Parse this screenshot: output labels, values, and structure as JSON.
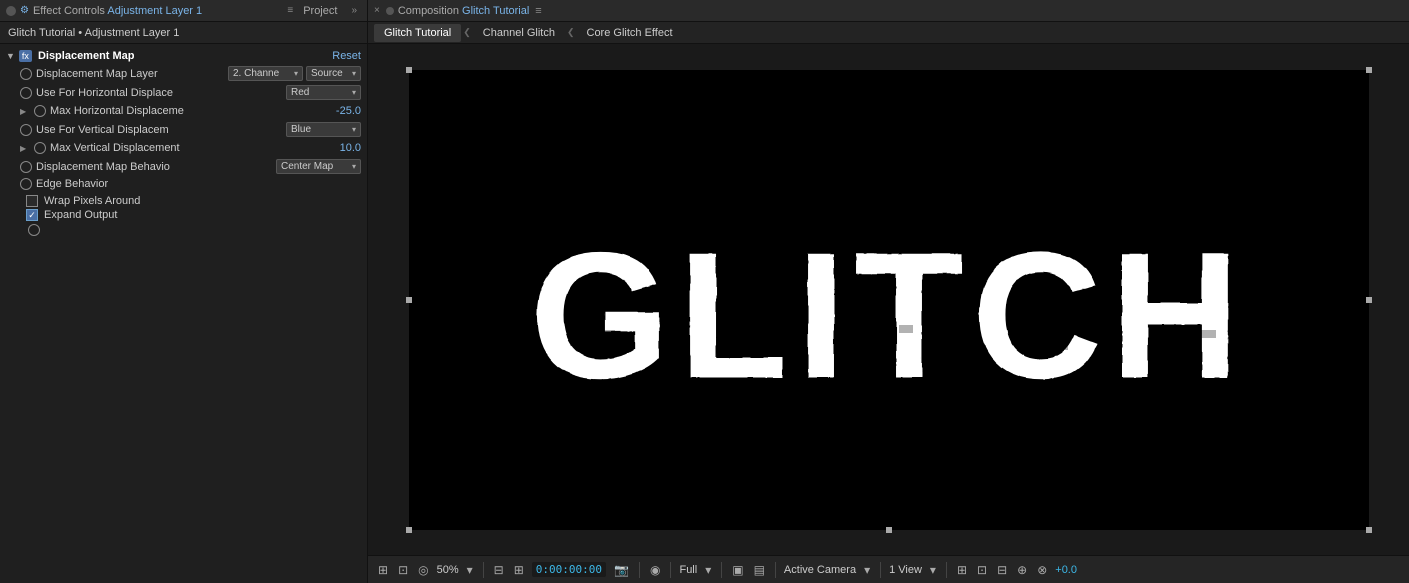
{
  "topBar": {
    "closeBtn": "×",
    "fxIcon": "fx",
    "panelTitle": "Effect Controls",
    "panelTitleHighlight": "Adjustment Layer 1",
    "menuIcon": "≡",
    "projectLabel": "Project",
    "expandIcon": "»",
    "rightClose": "×",
    "rightSaveDot": "●",
    "compLabel": "Composition",
    "compName": "Glitch Tutorial",
    "rightMenuIcon": "≡"
  },
  "secondRow": {
    "breadcrumb": "Glitch Tutorial • Adjustment Layer 1",
    "tabs": [
      {
        "id": "glitch-tutorial",
        "label": "Glitch Tutorial",
        "active": true
      },
      {
        "id": "channel-glitch",
        "label": "Channel Glitch",
        "active": false
      },
      {
        "id": "core-glitch",
        "label": "Core Glitch Effect",
        "active": false
      }
    ]
  },
  "effectControls": {
    "effectName": "Displacement Map",
    "resetLabel": "Reset",
    "rows": [
      {
        "id": "displacement-map-layer",
        "label": "Displacement Map Layer",
        "hasTriangle": false,
        "hasStopwatch": false,
        "valueType": "double-dropdown",
        "value1": "2. Channe",
        "value2": "Source"
      },
      {
        "id": "use-horizontal",
        "label": "Use For Horizontal Displace",
        "hasTriangle": false,
        "hasStopwatch": true,
        "valueType": "dropdown",
        "value": "Red"
      },
      {
        "id": "max-horizontal",
        "label": "Max Horizontal Displaceme",
        "hasTriangle": true,
        "hasStopwatch": true,
        "valueType": "number",
        "value": "-25.0"
      },
      {
        "id": "use-vertical",
        "label": "Use For Vertical Displacem",
        "hasTriangle": false,
        "hasStopwatch": true,
        "valueType": "dropdown",
        "value": "Blue"
      },
      {
        "id": "max-vertical",
        "label": "Max Vertical Displacement",
        "hasTriangle": true,
        "hasStopwatch": true,
        "valueType": "number",
        "value": "10.0"
      },
      {
        "id": "map-behavior",
        "label": "Displacement Map Behavio",
        "hasTriangle": false,
        "hasStopwatch": true,
        "valueType": "dropdown",
        "value": "Center Map"
      }
    ],
    "edgeBehavior": {
      "label": "Edge Behavior",
      "wrapLabel": "Wrap Pixels Around",
      "wrapChecked": false,
      "expandLabel": "Expand Output",
      "expandChecked": true
    }
  },
  "bottomBar": {
    "zoomValue": "50%",
    "timecode": "0:00:00:00",
    "qualityLabel": "Full",
    "cameraLabel": "Active Camera",
    "viewLabel": "1 View",
    "plusLabel": "+0.0"
  }
}
